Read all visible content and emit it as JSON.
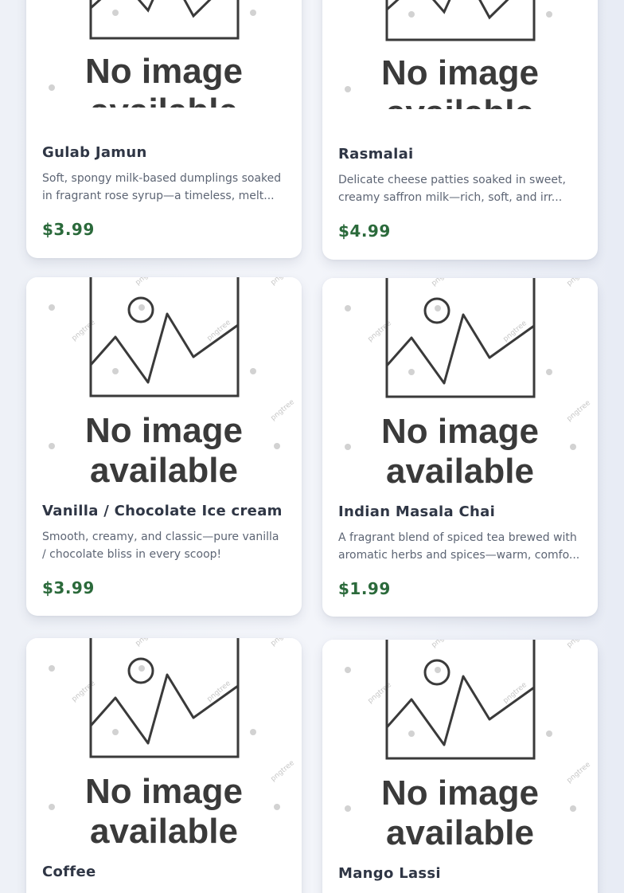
{
  "menu": {
    "placeholder_text": [
      "No image",
      "available"
    ],
    "items": [
      {
        "title": "Gulab Jamun",
        "description": "Soft, spongy milk-based dumplings soaked in fragrant rose syrup—a timeless, melt...",
        "price": "$3.99"
      },
      {
        "title": "Rasmalai",
        "description": "Delicate cheese patties soaked in sweet, creamy saffron milk—rich, soft, and irr...",
        "price": "$4.99"
      },
      {
        "title": "Vanilla / Chocolate Ice cream",
        "description": "Smooth, creamy, and classic—pure vanilla / chocolate bliss in every scoop!",
        "price": "$3.99"
      },
      {
        "title": "Indian Masala Chai",
        "description": "A fragrant blend of spiced tea brewed with aromatic herbs and spices—warm, comfo...",
        "price": "$1.99"
      },
      {
        "title": "Coffee",
        "description": "",
        "price": ""
      },
      {
        "title": "Mango Lassi",
        "description": "",
        "price": ""
      }
    ]
  },
  "colors": {
    "price": "#2b6a3b",
    "title": "#2f3645",
    "description": "#5d6574",
    "card": "#ffffff",
    "page_background": "#eef1f7"
  },
  "icons": {
    "placeholder": "image-placeholder-icon"
  }
}
